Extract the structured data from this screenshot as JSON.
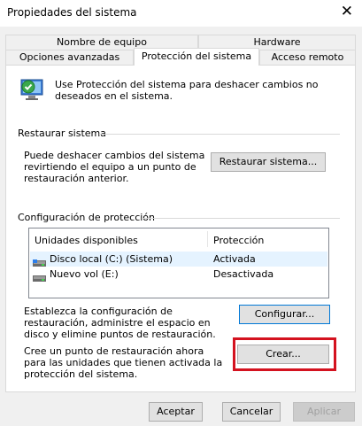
{
  "window": {
    "title": "Propiedades del sistema",
    "close_glyph": "✕"
  },
  "tabs": {
    "row1": [
      "Nombre de equipo",
      "Hardware"
    ],
    "row2": [
      "Opciones avanzadas",
      "Protección del sistema",
      "Acceso remoto"
    ],
    "active": "Protección del sistema"
  },
  "intro": {
    "icon": "system-protection-icon",
    "text": "Use Protección del sistema para deshacer cambios no deseados en el sistema."
  },
  "restore": {
    "group_label": "Restaurar sistema",
    "description": "Puede deshacer cambios del sistema revirtiendo el equipo a un punto de restauración anterior.",
    "button_label": "Restaurar sistema..."
  },
  "protection": {
    "group_label": "Configuración de protección",
    "columns": [
      "Unidades disponibles",
      "Protección"
    ],
    "rows": [
      {
        "drive": "Disco local (C:) (Sistema)",
        "status": "Activada",
        "icon": "system-drive-icon"
      },
      {
        "drive": "Nuevo vol (E:)",
        "status": "Desactivada",
        "icon": "drive-icon"
      }
    ],
    "configure_text": "Establezca la configuración de restauración, administre el espacio en disco y elimine puntos de restauración.",
    "configure_button": "Configurar...",
    "create_text": "Cree un punto de restauración ahora para las unidades que tienen activada la protección del sistema.",
    "create_button": "Crear..."
  },
  "footer": {
    "ok": "Aceptar",
    "cancel": "Cancelar",
    "apply": "Aplicar"
  },
  "colors": {
    "highlight": "#d4121f",
    "focus_border": "#0078d7",
    "selected_row": "#e5f3ff"
  }
}
